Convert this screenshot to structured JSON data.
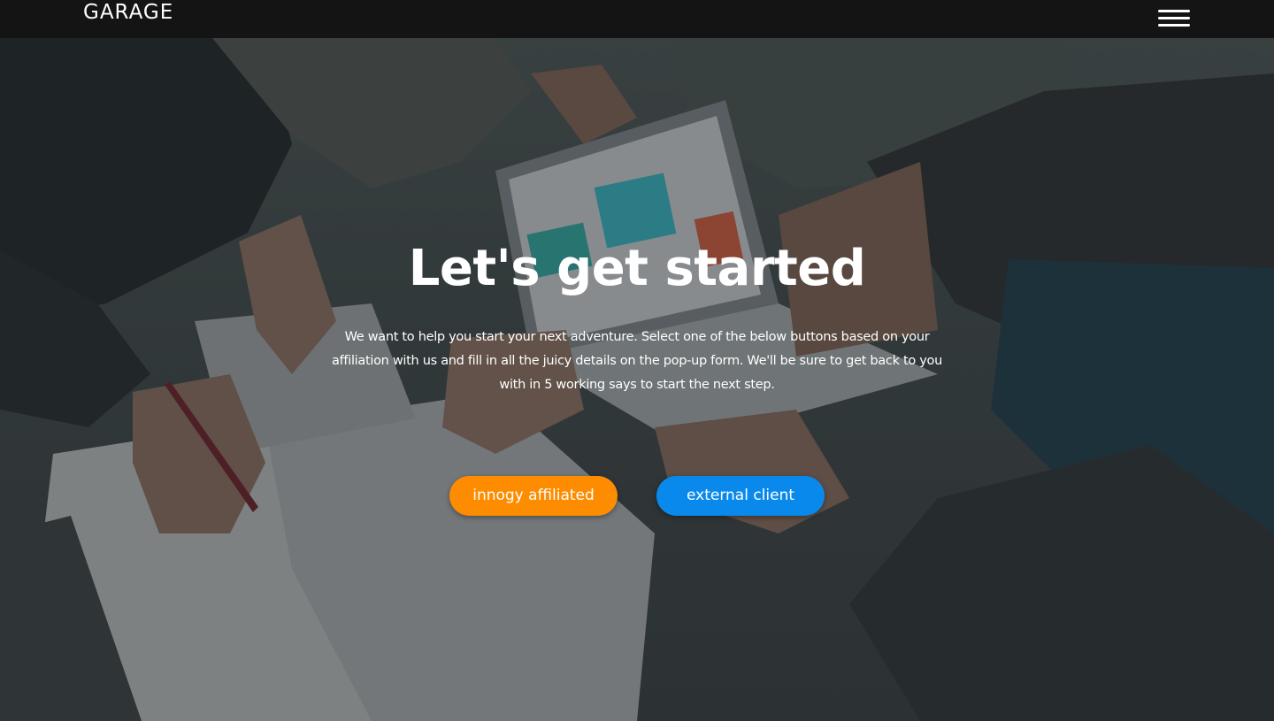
{
  "navbar": {
    "logo": "GARAGE",
    "menu_icon": "hamburger-menu-icon"
  },
  "hero": {
    "background": "team-working-on-laptop-photo",
    "headline": "Let's get started",
    "intro": "We want to help you start your next adventure. Select one of the below buttons based on your affiliation with us and fill in all the juicy details on the pop-up form. We'll be sure to get back to you with in 5 working says to start the next step.",
    "buttons": {
      "affiliated": "innogy affiliated",
      "external": "external client"
    }
  },
  "colors": {
    "navbar": "#141414",
    "orange_button": "#fd8c00",
    "blue_button": "#0a89ec",
    "text": "#ffffff"
  }
}
